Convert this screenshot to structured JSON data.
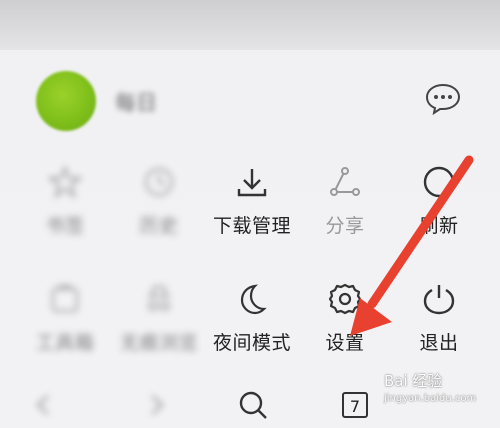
{
  "profile": {
    "username": "每日"
  },
  "menu_row1": [
    {
      "label": "书签",
      "icon": "star-icon",
      "blurred": true
    },
    {
      "label": "历史",
      "icon": "history-icon",
      "blurred": true
    },
    {
      "label": "下载管理",
      "icon": "download-icon",
      "blurred": false
    },
    {
      "label": "分享",
      "icon": "share-icon",
      "blurred": false,
      "muted": true
    },
    {
      "label": "刷新",
      "icon": "refresh-icon",
      "blurred": false
    }
  ],
  "menu_row2": [
    {
      "label": "工具箱",
      "icon": "toolbox-icon",
      "blurred": true
    },
    {
      "label": "无痕浏览",
      "icon": "incognito-icon",
      "blurred": true
    },
    {
      "label": "夜间模式",
      "icon": "moon-icon",
      "blurred": false
    },
    {
      "label": "设置",
      "icon": "gear-icon",
      "blurred": false
    },
    {
      "label": "退出",
      "icon": "power-icon",
      "blurred": false
    }
  ],
  "bottom_bar": {
    "tab_count": "7"
  },
  "watermark": {
    "line1": "Bai 经验",
    "line2": "jingyan.baidu.com"
  },
  "colors": {
    "arrow": "#e8412f",
    "avatar": "#8cc622"
  }
}
